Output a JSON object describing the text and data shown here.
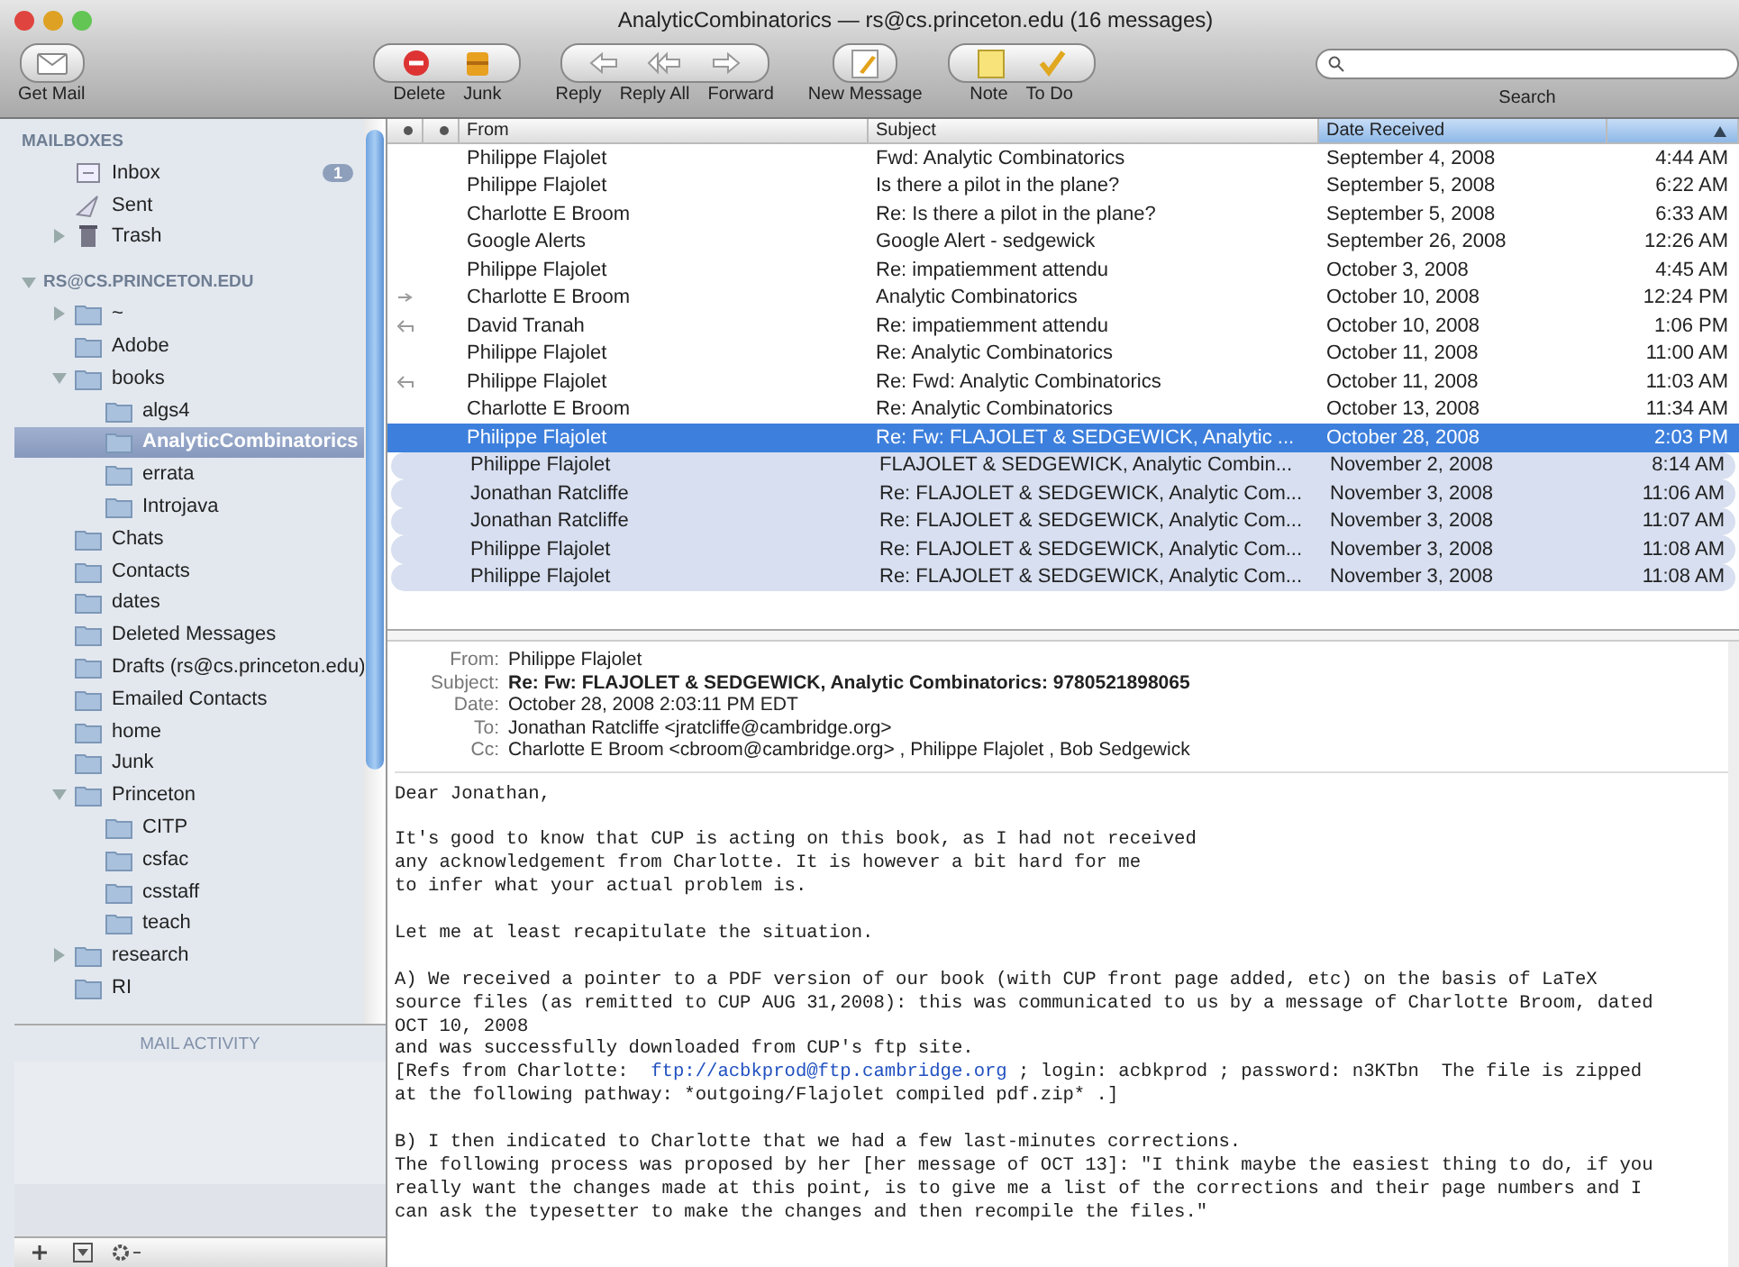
{
  "window": {
    "title": "AnalyticCombinatorics — rs@cs.princeton.edu (16 messages)"
  },
  "toolbar": {
    "groups": [
      [
        {
          "label": "Get Mail",
          "kind": "getmail"
        }
      ],
      [
        {
          "label": "Delete",
          "kind": "delete"
        },
        {
          "label": "Junk",
          "kind": "junk"
        }
      ],
      [
        {
          "label": "Reply",
          "kind": "reply"
        },
        {
          "label": "Reply All",
          "kind": "replyall"
        },
        {
          "label": "Forward",
          "kind": "forward"
        }
      ],
      [
        {
          "label": "New Message",
          "kind": "compose"
        }
      ],
      [
        {
          "label": "Note",
          "kind": "note"
        },
        {
          "label": "To Do",
          "kind": "todo"
        }
      ]
    ],
    "search": {
      "label": "Search"
    }
  },
  "sidebar": {
    "sections": [
      {
        "heading": "MAILBOXES",
        "items": [
          {
            "label": "Inbox",
            "kind": "inbox",
            "badge": "1",
            "selected": false
          },
          {
            "label": "Sent",
            "kind": "sent",
            "selected": false
          },
          {
            "label": "Trash",
            "kind": "trash",
            "expanded": false,
            "selected": false
          }
        ]
      },
      {
        "heading": "RS@CS.PRINCETON.EDU",
        "expanded": true,
        "items": [
          {
            "label": "~",
            "kind": "folder",
            "expanded": false,
            "selected": false
          },
          {
            "label": "Adobe",
            "kind": "folder",
            "selected": false
          },
          {
            "label": "books",
            "kind": "folder",
            "expanded": true,
            "selected": false,
            "children": [
              {
                "label": "algs4",
                "kind": "folder",
                "selected": false
              },
              {
                "label": "AnalyticCombinatorics",
                "kind": "folder",
                "selected": true
              },
              {
                "label": "errata",
                "kind": "folder",
                "selected": false
              },
              {
                "label": "Introjava",
                "kind": "folder",
                "selected": false
              }
            ]
          },
          {
            "label": "Chats",
            "kind": "folder",
            "selected": false
          },
          {
            "label": "Contacts",
            "kind": "folder",
            "selected": false
          },
          {
            "label": "dates",
            "kind": "folder",
            "selected": false
          },
          {
            "label": "Deleted Messages",
            "kind": "folder",
            "selected": false
          },
          {
            "label": "Drafts (rs@cs.princeton.edu)",
            "kind": "folder",
            "selected": false
          },
          {
            "label": "Emailed Contacts",
            "kind": "folder",
            "selected": false
          },
          {
            "label": "home",
            "kind": "folder",
            "selected": false
          },
          {
            "label": "Junk",
            "kind": "folder",
            "selected": false
          },
          {
            "label": "Princeton",
            "kind": "folder",
            "expanded": true,
            "selected": false,
            "children": [
              {
                "label": "CITP",
                "kind": "folder",
                "selected": false
              },
              {
                "label": "csfac",
                "kind": "folder",
                "selected": false
              },
              {
                "label": "csstaff",
                "kind": "folder",
                "selected": false
              },
              {
                "label": "teach",
                "kind": "folder",
                "selected": false
              }
            ]
          },
          {
            "label": "research",
            "kind": "folder",
            "expanded": false,
            "selected": false
          },
          {
            "label": "RI",
            "kind": "folder",
            "selected": false
          }
        ]
      }
    ],
    "activity": {
      "heading": "MAIL ACTIVITY"
    }
  },
  "messages": {
    "columns": [
      {
        "label": "From",
        "sorted": false
      },
      {
        "label": "Subject",
        "sorted": false
      },
      {
        "label": "Date Received",
        "sorted": true
      }
    ],
    "rows": [
      {
        "from": "Philippe Flajolet",
        "subject": "Fwd: Analytic Combinatorics",
        "date": "September 4, 2008",
        "time": "4:44 AM",
        "forwarded": false,
        "replied": false,
        "thread": false,
        "selected": false
      },
      {
        "from": "Philippe Flajolet",
        "subject": "Is there a pilot in the plane?",
        "date": "September 5, 2008",
        "time": "6:22 AM",
        "forwarded": false,
        "replied": false,
        "thread": false,
        "selected": false
      },
      {
        "from": "Charlotte E Broom",
        "subject": "Re: Is there a pilot in the plane?",
        "date": "September 5, 2008",
        "time": "6:33 AM",
        "forwarded": false,
        "replied": false,
        "thread": false,
        "selected": false
      },
      {
        "from": "Google Alerts",
        "subject": "Google Alert - sedgewick",
        "date": "September 26, 2008",
        "time": "12:26 AM",
        "forwarded": false,
        "replied": false,
        "thread": false,
        "selected": false
      },
      {
        "from": "Philippe Flajolet",
        "subject": "Re: impatiemment attendu",
        "date": "October 3, 2008",
        "time": "4:45 AM",
        "forwarded": false,
        "replied": false,
        "thread": false,
        "selected": false
      },
      {
        "from": "Charlotte E Broom",
        "subject": "Analytic Combinatorics",
        "date": "October 10, 2008",
        "time": "12:24 PM",
        "forwarded": true,
        "replied": false,
        "thread": false,
        "selected": false
      },
      {
        "from": "David Tranah",
        "subject": "Re: impatiemment attendu",
        "date": "October 10, 2008",
        "time": "1:06 PM",
        "forwarded": false,
        "replied": true,
        "thread": false,
        "selected": false
      },
      {
        "from": "Philippe Flajolet",
        "subject": "Re: Analytic Combinatorics",
        "date": "October 11, 2008",
        "time": "11:00 AM",
        "forwarded": false,
        "replied": false,
        "thread": false,
        "selected": false
      },
      {
        "from": "Philippe Flajolet",
        "subject": "Re: Fwd: Analytic Combinatorics",
        "date": "October 11, 2008",
        "time": "11:03 AM",
        "forwarded": false,
        "replied": true,
        "thread": false,
        "selected": false
      },
      {
        "from": "Charlotte E Broom",
        "subject": "Re: Analytic Combinatorics",
        "date": "October 13, 2008",
        "time": "11:34 AM",
        "forwarded": false,
        "replied": false,
        "thread": false,
        "selected": false
      },
      {
        "from": "Philippe Flajolet",
        "subject": "Re: Fw: FLAJOLET & SEDGEWICK, Analytic ...",
        "date": "October 28, 2008",
        "time": "2:03 PM",
        "forwarded": false,
        "replied": false,
        "thread": true,
        "selected": true
      },
      {
        "from": "Philippe Flajolet",
        "subject": "FLAJOLET & SEDGEWICK, Analytic Combin...",
        "date": "November 2, 2008",
        "time": "8:14 AM",
        "forwarded": false,
        "replied": false,
        "thread": true,
        "selected": false
      },
      {
        "from": "Jonathan Ratcliffe",
        "subject": "Re: FLAJOLET & SEDGEWICK, Analytic Com...",
        "date": "November 3, 2008",
        "time": "11:06 AM",
        "forwarded": false,
        "replied": false,
        "thread": true,
        "selected": false
      },
      {
        "from": "Jonathan Ratcliffe",
        "subject": "Re: FLAJOLET & SEDGEWICK, Analytic Com...",
        "date": "November 3, 2008",
        "time": "11:07 AM",
        "forwarded": false,
        "replied": false,
        "thread": true,
        "selected": false
      },
      {
        "from": "Philippe Flajolet",
        "subject": "Re: FLAJOLET & SEDGEWICK, Analytic Com...",
        "date": "November 3, 2008",
        "time": "11:08 AM",
        "forwarded": false,
        "replied": false,
        "thread": true,
        "selected": false
      },
      {
        "from": "Philippe Flajolet",
        "subject": "Re: FLAJOLET & SEDGEWICK, Analytic Com...",
        "date": "November 3, 2008",
        "time": "11:08 AM",
        "forwarded": false,
        "replied": false,
        "thread": true,
        "selected": false
      }
    ]
  },
  "preview": {
    "headers": [
      {
        "label": "From:",
        "value": "Philippe Flajolet",
        "bold": false
      },
      {
        "label": "Subject:",
        "value": "Re: Fw: FLAJOLET & SEDGEWICK, Analytic Combinatorics: 9780521898065",
        "bold": true
      },
      {
        "label": "Date:",
        "value": "October 28, 2008 2:03:11 PM EDT",
        "bold": false
      },
      {
        "label": "To:",
        "value": "Jonathan Ratcliffe <jratcliffe@cambridge.org>",
        "bold": false
      },
      {
        "label": "Cc:",
        "value": "Charlotte E Broom <cbroom@cambridge.org> ,  Philippe Flajolet ,  Bob Sedgewick",
        "bold": false
      }
    ],
    "body": [
      {
        "text": "Dear Jonathan,"
      },
      {
        "text": "It's good to know that CUP is acting on this book, as I had not received\nany acknowledgement from Charlotte. It is however a bit hard for me\nto infer what your actual problem is."
      },
      {
        "text": "Let me at least recapitulate the situation."
      },
      {
        "text": "A) We received a pointer to a PDF version of our book (with CUP front page added, etc) on the basis of LaTeX\nsource files (as remitted to CUP AUG 31,2008): this was communicated to us by a message of Charlotte Broom, dated\nOCT 10, 2008\nand was successfully downloaded from CUP's ftp site.\n[Refs from Charlotte:  ",
        "link": "ftp://acbkprod@ftp.cambridge.org",
        "after": " ; login: acbkprod ; password: n3KTbn  The file is zipped\nat the following pathway: *outgoing/Flajolet compiled pdf.zip* .]"
      },
      {
        "text": "B) I then indicated to Charlotte that we had a few last-minutes corrections.\nThe following process was proposed by her [her message of OCT 13]: \"I think maybe the easiest thing to do, if you\nreally want the changes made at this point, is to give me a list of the corrections and their page numbers and I\ncan ask the typesetter to make the changes and then recompile the files.\""
      }
    ]
  }
}
